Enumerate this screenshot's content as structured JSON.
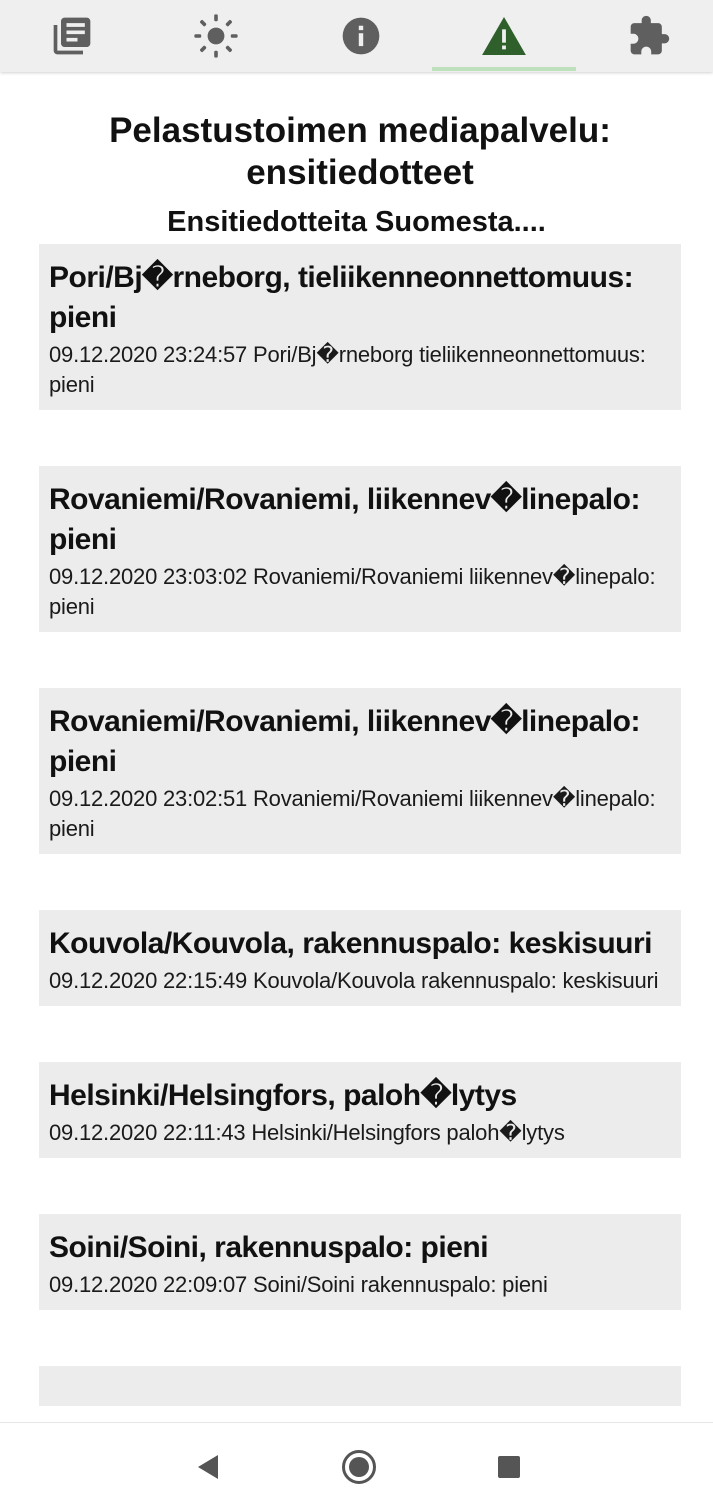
{
  "tabs": [
    {
      "icon": "news-icon"
    },
    {
      "icon": "weather-sun-icon"
    },
    {
      "icon": "info-icon"
    },
    {
      "icon": "warning-icon",
      "active": true
    },
    {
      "icon": "puzzle-icon"
    }
  ],
  "colors": {
    "active_icon": "#2f5f2b",
    "inactive_icon": "#5f5f5f",
    "active_underline": "#bfe0bd",
    "card_background": "#ececec"
  },
  "header": {
    "title": "Pelastustoimen mediapalvelu: ensitiedotteet",
    "subtitle": "Ensitiedotteita Suomesta...."
  },
  "items": [
    {
      "title": "Pori/Bj�rneborg, tieliikenneonnettomuus: pieni",
      "desc": "09.12.2020 23:24:57 Pori/Bj�rneborg tieliikenneonnettomuus: pieni"
    },
    {
      "title": "Rovaniemi/Rovaniemi, liikennev�linepalo: pieni",
      "desc": "09.12.2020 23:03:02 Rovaniemi/Rovaniemi liikennev�linepalo: pieni"
    },
    {
      "title": "Rovaniemi/Rovaniemi, liikennev�linepalo: pieni",
      "desc": "09.12.2020 23:02:51 Rovaniemi/Rovaniemi liikennev�linepalo: pieni"
    },
    {
      "title": "Kouvola/Kouvola, rakennuspalo: keskisuuri",
      "desc": "09.12.2020 22:15:49 Kouvola/Kouvola rakennuspalo: keskisuuri"
    },
    {
      "title": "Helsinki/Helsingfors, paloh�lytys",
      "desc": "09.12.2020 22:11:43 Helsinki/Helsingfors paloh�lytys"
    },
    {
      "title": "Soini/Soini, rakennuspalo: pieni",
      "desc": "09.12.2020 22:09:07 Soini/Soini rakennuspalo: pieni"
    }
  ],
  "system_nav": [
    {
      "icon": "back-icon"
    },
    {
      "icon": "home-icon"
    },
    {
      "icon": "recents-icon"
    }
  ]
}
